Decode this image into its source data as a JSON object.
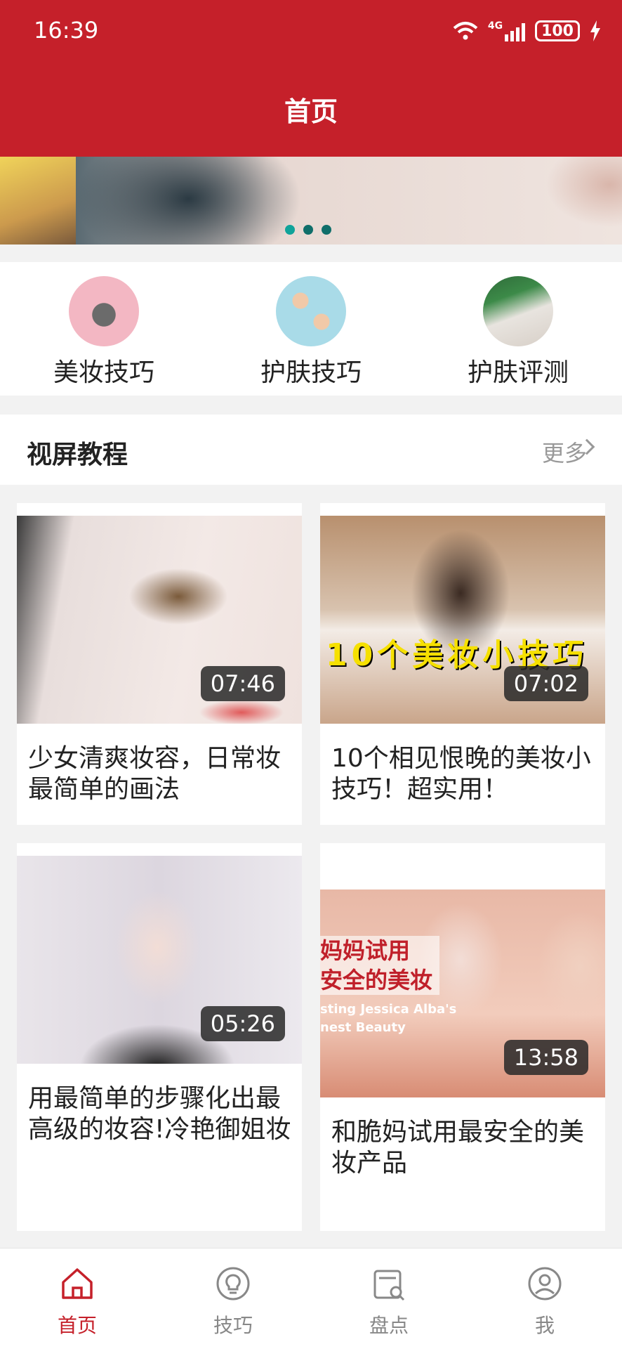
{
  "status_bar": {
    "time": "16:39",
    "network": "4G",
    "battery": "100"
  },
  "header": {
    "title": "首页"
  },
  "banner": {
    "dots": 3,
    "active_dot": 0
  },
  "categories": [
    {
      "label": "美妆技巧",
      "icon": "makeup-brushes-image"
    },
    {
      "label": "护肤技巧",
      "icon": "skincare-pattern-image"
    },
    {
      "label": "护肤评测",
      "icon": "skincare-review-image"
    }
  ],
  "section": {
    "title": "视屏教程",
    "more": "更多"
  },
  "videos": [
    {
      "title": "少女清爽妆容，日常妆最简单的画法",
      "duration": "07:46"
    },
    {
      "title": "10个相见恨晚的美妆小技巧！超实用！",
      "duration": "07:02",
      "thumb_overlay": "10个美妆小技巧"
    },
    {
      "title": "用最简单的步骤化出最高级的妆容!冷艳御姐妆",
      "duration": "05:26"
    },
    {
      "title": "和脆妈试用最安全的美妆产品",
      "duration": "13:58",
      "thumb_overlay": "妈妈试用 安全的美妆",
      "thumb_overlay_en": "sting Jessica Alba's nest Beauty"
    }
  ],
  "tabbar": [
    {
      "label": "首页",
      "icon": "home-icon",
      "active": true
    },
    {
      "label": "技巧",
      "icon": "lightbulb-icon",
      "active": false
    },
    {
      "label": "盘点",
      "icon": "inventory-search-icon",
      "active": false
    },
    {
      "label": "我",
      "icon": "profile-icon",
      "active": false
    }
  ],
  "colors": {
    "primary": "#c5202a",
    "accent_dot": "#10a39a",
    "background": "#f2f2f2"
  }
}
